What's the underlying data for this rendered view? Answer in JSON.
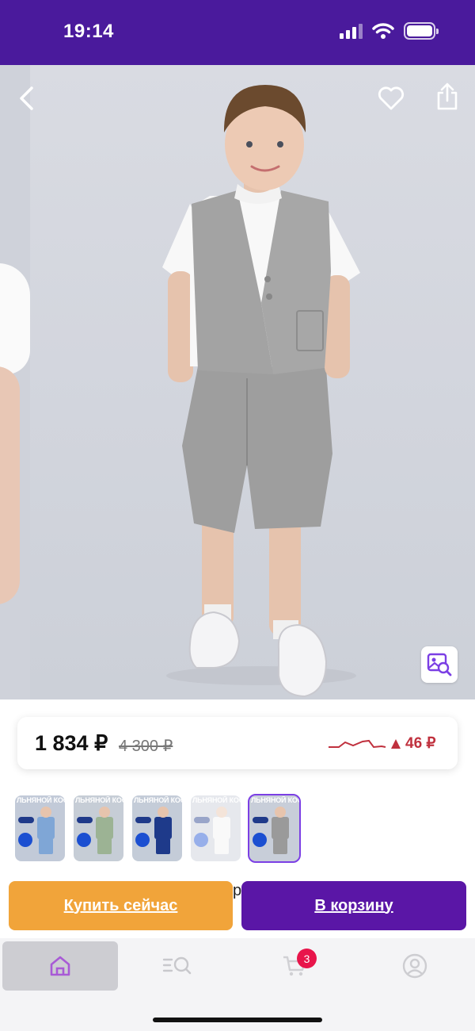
{
  "status_bar": {
    "time": "19:14",
    "icons": [
      "signal-icon",
      "wifi-icon",
      "battery-icon"
    ]
  },
  "photo": {
    "actions": [
      "back-icon",
      "favorite-icon",
      "share-icon",
      "image-search-icon"
    ]
  },
  "price": {
    "current": "1 834 ₽",
    "old": "4 300 ₽",
    "change": "46 ₽",
    "trend_direction": "up",
    "trend_color": "#c0313e"
  },
  "thumbnails": [
    {
      "title": "ЛЬНЯНОЙ КОСТЮМ",
      "outfit": "#7fa6d6",
      "shorts": "#7fa6d6",
      "bg": "#c2cad8",
      "faded": false,
      "selected": false
    },
    {
      "title": "ЛЬНЯНОЙ КОСТЮМ",
      "outfit": "#9cb394",
      "shorts": "#9cb394",
      "bg": "#c6cdd6",
      "faded": false,
      "selected": false
    },
    {
      "title": "ЛЬНЯНОЙ КОСТЮМ",
      "outfit": "#1e3a8a",
      "shorts": "#1e3a8a",
      "bg": "#c4ccd8",
      "faded": false,
      "selected": false
    },
    {
      "title": "ЛЬНЯНОЙ КОСТЮМ",
      "outfit": "#f2f2f2",
      "shorts": "#f2f2f2",
      "bg": "#c8ced9",
      "faded": true,
      "selected": false
    },
    {
      "title": "ЛЬНЯНОЙ КОСТЮМ",
      "outfit": "#9a9a9a",
      "shorts": "#9a9a9a",
      "bg": "#c8ced9",
      "faded": false,
      "selected": true
    }
  ],
  "buttons": {
    "buy_now": "Купить сейчас",
    "add_to_cart": "В корзину"
  },
  "peek_text": "р",
  "bottom_nav": {
    "items": [
      "home-icon",
      "catalog-search-icon",
      "cart-icon",
      "profile-icon"
    ],
    "active": "home-icon",
    "cart_count": "3"
  },
  "colors": {
    "brand": "#4a1a9c",
    "buy": "#f1a43a",
    "cart": "#5a16a6",
    "badge": "#e8154b"
  }
}
